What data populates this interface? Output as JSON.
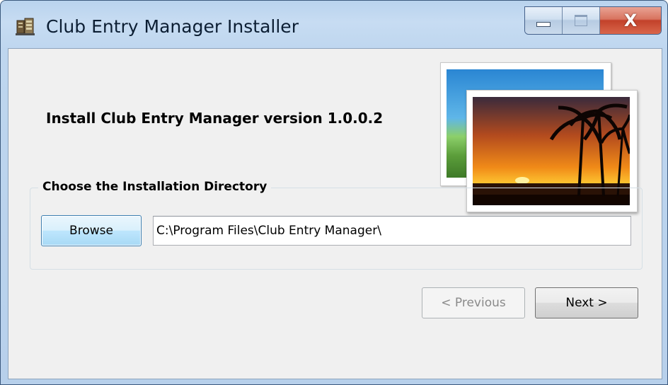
{
  "window": {
    "title": "Club Entry Manager Installer",
    "icons": {
      "app": "installer-app-icon",
      "minimize": "minimize-icon",
      "maximize": "maximize-icon",
      "close": "close-icon"
    },
    "close_glyph": "X"
  },
  "main": {
    "heading": "Install Club Entry Manager version 1.0.0.2",
    "banner_image": "stacked-photos-sunset-palm-trees"
  },
  "directory": {
    "group_label": "Choose the Installation Directory",
    "browse_label": "Browse",
    "path_value": "C:\\Program Files\\Club Entry Manager\\"
  },
  "footer": {
    "previous_label": "< Previous",
    "next_label": "Next >"
  },
  "colors": {
    "titlebar": "#bfd6ef",
    "client_bg": "#f0f0f0",
    "close_button": "#c8452c",
    "focus_border": "#3c7fb1"
  }
}
